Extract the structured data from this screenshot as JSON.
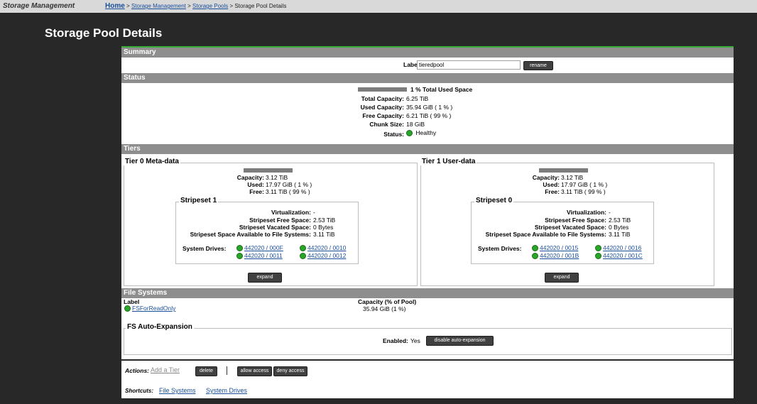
{
  "app": {
    "title": "Storage Management"
  },
  "breadcrumb": {
    "home": "Home",
    "sep": ">",
    "sm": "Storage Management",
    "pools": "Storage Pools",
    "current": "Storage Pool Details"
  },
  "page": {
    "title": "Storage Pool Details"
  },
  "summary": {
    "header": "Summary",
    "label_label": "Label:",
    "label_value": "tieredpool",
    "rename": "rename"
  },
  "status": {
    "header": "Status",
    "used_pct_text": "1 % Total Used Space",
    "used_fraction": 0.01,
    "total_capacity_label": "Total Capacity:",
    "total_capacity": "6.25 TiB",
    "used_capacity_label": "Used Capacity:",
    "used_capacity": "35.94 GiB ( 1 % )",
    "free_capacity_label": "Free Capacity:",
    "free_capacity": "6.21 TiB ( 99 % )",
    "chunk_size_label": "Chunk Size:",
    "chunk_size": "18 GiB",
    "status_label": "Status:",
    "status_value": "Healthy",
    "status_color": "#2aa52a"
  },
  "tiers": {
    "header": "Tiers",
    "t0": {
      "title": "Tier 0 Meta-data",
      "used_fraction": 0.01,
      "capacity_label": "Capacity:",
      "capacity": "3.12 TiB",
      "used_label": "Used:",
      "used": "17.97 GiB ( 1 % )",
      "free_label": "Free:",
      "free": "3.11 TiB ( 99 % )",
      "stripeset": {
        "title": "Stripeset 1",
        "virt_label": "Virtualization:",
        "virt": "-",
        "sfs_label": "Stripeset Free Space:",
        "sfs": "2.53 TiB",
        "svs_label": "Stripeset Vacated Space:",
        "svs": "0 Bytes",
        "ssa_label": "Stripeset Space Available to File Systems:",
        "ssa": "3.11 TiB",
        "drives_label": "System Drives:",
        "drives": [
          "442020 / 000F",
          "442020 / 0010",
          "442020 / 0011",
          "442020 / 0012"
        ]
      },
      "expand": "expand"
    },
    "t1": {
      "title": "Tier 1 User-data",
      "used_fraction": 0.01,
      "capacity_label": "Capacity:",
      "capacity": "3.12 TiB",
      "used_label": "Used:",
      "used": "17.97 GiB ( 1 % )",
      "free_label": "Free:",
      "free": "3.11 TiB ( 99 % )",
      "stripeset": {
        "title": "Stripeset 0",
        "virt_label": "Virtualization:",
        "virt": "-",
        "sfs_label": "Stripeset Free Space:",
        "sfs": "2.53 TiB",
        "svs_label": "Stripeset Vacated Space:",
        "svs": "0 Bytes",
        "ssa_label": "Stripeset Space Available to File Systems:",
        "ssa": "3.11 TiB",
        "drives_label": "System Drives:",
        "drives": [
          "442020 / 0015",
          "442020 / 0016",
          "442020 / 001B",
          "442020 / 001C"
        ]
      },
      "expand": "expand"
    }
  },
  "filesystems": {
    "header": "File Systems",
    "col_label": "Label",
    "col_capacity": "Capacity (% of Pool)",
    "rows": [
      {
        "label": "FSForReadOnly",
        "capacity": "35.94 GiB (1 %)"
      }
    ]
  },
  "autoexp": {
    "title": "FS Auto-Expansion",
    "enabled_label": "Enabled:",
    "enabled_value": "Yes",
    "button": "disable auto-expansion"
  },
  "actions": {
    "label": "Actions:",
    "add_tier": "Add a Tier",
    "delete": "delete",
    "allow": "allow access",
    "deny": "deny access",
    "shortcuts_label": "Shortcuts:",
    "sc_fs": "File Systems",
    "sc_sd": "System Drives"
  }
}
